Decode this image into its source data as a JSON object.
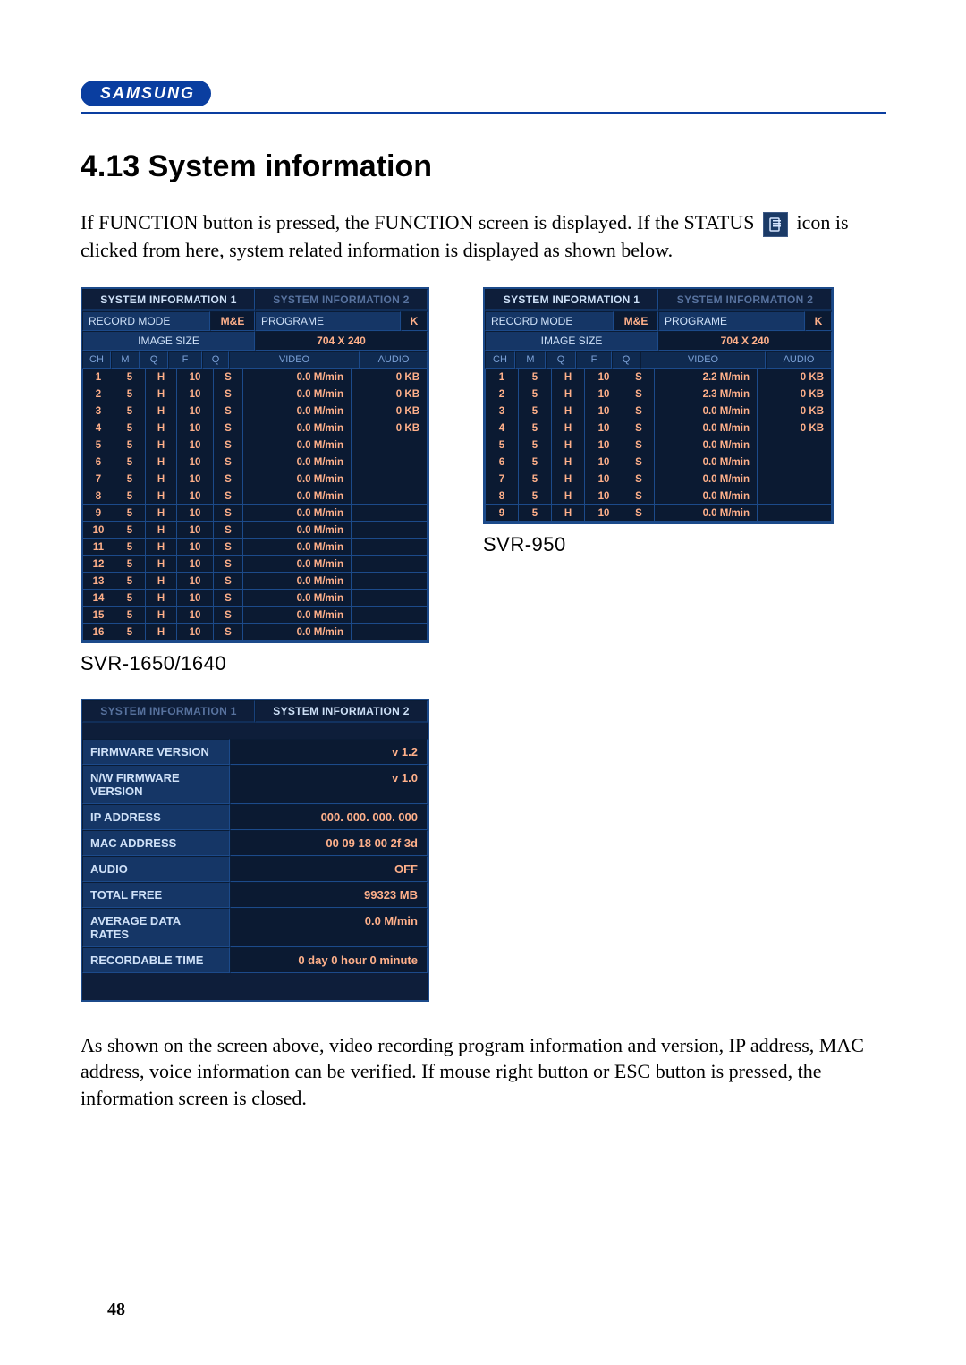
{
  "brand": "SAMSUNG",
  "heading": "4.13 System information",
  "intro_a": "If FUNCTION button is pressed, the FUNCTION screen is displayed. If the STATUS",
  "intro_b": "icon is clicked from here, system related information is displayed as shown below.",
  "model_labels": {
    "left": "SVR-1650/1640",
    "right": "SVR-950"
  },
  "common": {
    "tab1": "SYSTEM INFORMATION 1",
    "tab2": "SYSTEM INFORMATION 2",
    "record_mode": "RECORD MODE",
    "mne": "M&E",
    "programe": "PROGRAME",
    "k": "K",
    "image_size": "IMAGE SIZE",
    "image_size_val": "704 X 240",
    "cols": {
      "ch": "CH",
      "m": "M",
      "q": "Q",
      "f": "F",
      "q2": "Q",
      "video": "VIDEO",
      "audio": "AUDIO"
    }
  },
  "svr16": {
    "rows": [
      {
        "ch": "1",
        "m": "5",
        "q": "H",
        "f": "10",
        "q2": "S",
        "video": "0.0 M/min",
        "audio": "0 KB"
      },
      {
        "ch": "2",
        "m": "5",
        "q": "H",
        "f": "10",
        "q2": "S",
        "video": "0.0 M/min",
        "audio": "0 KB"
      },
      {
        "ch": "3",
        "m": "5",
        "q": "H",
        "f": "10",
        "q2": "S",
        "video": "0.0 M/min",
        "audio": "0 KB"
      },
      {
        "ch": "4",
        "m": "5",
        "q": "H",
        "f": "10",
        "q2": "S",
        "video": "0.0 M/min",
        "audio": "0 KB"
      },
      {
        "ch": "5",
        "m": "5",
        "q": "H",
        "f": "10",
        "q2": "S",
        "video": "0.0 M/min",
        "audio": ""
      },
      {
        "ch": "6",
        "m": "5",
        "q": "H",
        "f": "10",
        "q2": "S",
        "video": "0.0 M/min",
        "audio": ""
      },
      {
        "ch": "7",
        "m": "5",
        "q": "H",
        "f": "10",
        "q2": "S",
        "video": "0.0 M/min",
        "audio": ""
      },
      {
        "ch": "8",
        "m": "5",
        "q": "H",
        "f": "10",
        "q2": "S",
        "video": "0.0 M/min",
        "audio": ""
      },
      {
        "ch": "9",
        "m": "5",
        "q": "H",
        "f": "10",
        "q2": "S",
        "video": "0.0 M/min",
        "audio": ""
      },
      {
        "ch": "10",
        "m": "5",
        "q": "H",
        "f": "10",
        "q2": "S",
        "video": "0.0 M/min",
        "audio": ""
      },
      {
        "ch": "11",
        "m": "5",
        "q": "H",
        "f": "10",
        "q2": "S",
        "video": "0.0 M/min",
        "audio": ""
      },
      {
        "ch": "12",
        "m": "5",
        "q": "H",
        "f": "10",
        "q2": "S",
        "video": "0.0 M/min",
        "audio": ""
      },
      {
        "ch": "13",
        "m": "5",
        "q": "H",
        "f": "10",
        "q2": "S",
        "video": "0.0 M/min",
        "audio": ""
      },
      {
        "ch": "14",
        "m": "5",
        "q": "H",
        "f": "10",
        "q2": "S",
        "video": "0.0 M/min",
        "audio": ""
      },
      {
        "ch": "15",
        "m": "5",
        "q": "H",
        "f": "10",
        "q2": "S",
        "video": "0.0 M/min",
        "audio": ""
      },
      {
        "ch": "16",
        "m": "5",
        "q": "H",
        "f": "10",
        "q2": "S",
        "video": "0.0 M/min",
        "audio": ""
      }
    ]
  },
  "svr9": {
    "rows": [
      {
        "ch": "1",
        "m": "5",
        "q": "H",
        "f": "10",
        "q2": "S",
        "video": "2.2 M/min",
        "audio": "0 KB"
      },
      {
        "ch": "2",
        "m": "5",
        "q": "H",
        "f": "10",
        "q2": "S",
        "video": "2.3 M/min",
        "audio": "0 KB"
      },
      {
        "ch": "3",
        "m": "5",
        "q": "H",
        "f": "10",
        "q2": "S",
        "video": "0.0 M/min",
        "audio": "0 KB"
      },
      {
        "ch": "4",
        "m": "5",
        "q": "H",
        "f": "10",
        "q2": "S",
        "video": "0.0 M/min",
        "audio": "0 KB"
      },
      {
        "ch": "5",
        "m": "5",
        "q": "H",
        "f": "10",
        "q2": "S",
        "video": "0.0 M/min",
        "audio": ""
      },
      {
        "ch": "6",
        "m": "5",
        "q": "H",
        "f": "10",
        "q2": "S",
        "video": "0.0 M/min",
        "audio": ""
      },
      {
        "ch": "7",
        "m": "5",
        "q": "H",
        "f": "10",
        "q2": "S",
        "video": "0.0 M/min",
        "audio": ""
      },
      {
        "ch": "8",
        "m": "5",
        "q": "H",
        "f": "10",
        "q2": "S",
        "video": "0.0 M/min",
        "audio": ""
      },
      {
        "ch": "9",
        "m": "5",
        "q": "H",
        "f": "10",
        "q2": "S",
        "video": "0.0 M/min",
        "audio": ""
      }
    ]
  },
  "sysdetails": {
    "rows": [
      {
        "k": "FIRMWARE VERSION",
        "v": "v 1.2"
      },
      {
        "k": "N/W FIRMWARE VERSION",
        "v": "v 1.0"
      },
      {
        "k": "IP ADDRESS",
        "v": "000. 000. 000. 000"
      },
      {
        "k": "MAC ADDRESS",
        "v": "00 09 18 00 2f 3d"
      },
      {
        "k": "AUDIO",
        "v": "OFF"
      },
      {
        "k": "TOTAL FREE",
        "v": "99323 MB"
      },
      {
        "k": "AVERAGE DATA RATES",
        "v": "0.0 M/min"
      },
      {
        "k": "RECORDABLE TIME",
        "v": "0 day     0 hour     0  minute"
      }
    ]
  },
  "outro": "As shown on the screen above, video recording program information and version, IP address, MAC address, voice information can be verified. If mouse right button or ESC button is pressed, the information screen is closed.",
  "page_number": "48"
}
